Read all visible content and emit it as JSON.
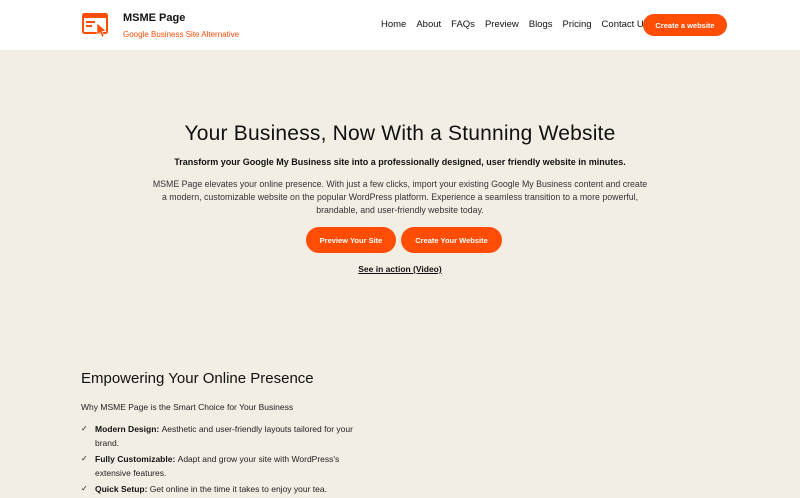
{
  "brand": {
    "name": "MSME Page",
    "tagline": "Google Business Site Alternative",
    "logo_icon": "browser-cursor-icon"
  },
  "nav": {
    "items": [
      "Home",
      "About",
      "FAQs",
      "Preview",
      "Blogs",
      "Pricing",
      "Contact Us"
    ],
    "cta_label": "Create a website"
  },
  "hero": {
    "title": "Your Business, Now With a Stunning Website",
    "subtitle": "Transform your Google My Business site into a professionally designed, user friendly website in minutes.",
    "description": "MSME Page elevates your online presence. With just a few clicks, import your existing Google My Business content and create a modern, customizable website on the popular WordPress platform. Experience a seamless transition to a more powerful, brandable, and user-friendly website today.",
    "preview_label": "Preview Your Site",
    "create_label": "Create Your Website",
    "video_link": "See in action (Video)"
  },
  "features": {
    "heading": "Empowering Your Online Presence",
    "why": "Why MSME Page is the Smart Choice for Your Business",
    "items": [
      {
        "title": "Modern Design:",
        "text": "Aesthetic and user-friendly layouts tailored for your brand."
      },
      {
        "title": "Fully Customizable:",
        "text": "Adapt and grow your site with WordPress's extensive features."
      },
      {
        "title": "Quick Setup:",
        "text": "Get online in the time it takes to enjoy your tea."
      }
    ],
    "check_icon": "check-icon"
  },
  "colors": {
    "accent": "#ff4d06",
    "background": "#f3eee4",
    "header": "#ffffff"
  }
}
